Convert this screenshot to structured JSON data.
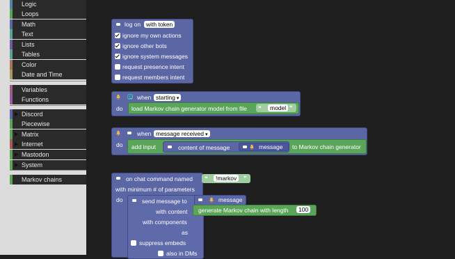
{
  "toolbox": {
    "categories": [
      {
        "label": "Logic",
        "color": "#5b80a5"
      },
      {
        "label": "Loops",
        "color": "#5ba55b"
      },
      {
        "label": "Math",
        "color": "#5b67a5"
      },
      {
        "label": "Text",
        "color": "#5ba58c"
      },
      {
        "label": "Lists",
        "color": "#745ba5"
      },
      {
        "label": "Tables",
        "color": "#5ba58c"
      },
      {
        "label": "Color",
        "color": "#a5745b"
      },
      {
        "label": "Date and Time",
        "color": "#a59b5b"
      },
      {
        "label": "Variables",
        "color": "#a55b80"
      },
      {
        "label": "Functions",
        "color": "#995ba5"
      },
      {
        "label": "Discord",
        "color": "#5b67a5"
      },
      {
        "label": "Piecewise",
        "color": "#5ba55b"
      },
      {
        "label": "Matrix",
        "color": "#5ba55b"
      },
      {
        "label": "Internet",
        "color": "#a55b5b"
      },
      {
        "label": "Mastodon",
        "color": "#5ba55b"
      },
      {
        "label": "System",
        "color": "#5ba55b"
      },
      {
        "label": "Markov chains",
        "color": "#5ba55b"
      }
    ]
  },
  "workspace": {
    "login": {
      "label": "log on",
      "token_field": "with token",
      "options": [
        {
          "label": "ignore my own actions",
          "checked": true
        },
        {
          "label": "ignore other bots",
          "checked": true
        },
        {
          "label": "ignore system messages",
          "checked": true
        },
        {
          "label": "request presence intent",
          "checked": false
        },
        {
          "label": "request members intent",
          "checked": false
        }
      ]
    },
    "starting": {
      "when": "when",
      "event": "starting",
      "do": "do",
      "action": "load Markov chain generator model from file",
      "file": "model"
    },
    "received": {
      "when": "when",
      "event": "message received",
      "do": "do",
      "add": "add input",
      "content": "content of message",
      "message": "message",
      "target": "to Markov chain generator"
    },
    "command": {
      "label": "on chat command named",
      "name": "!markov",
      "min": "with minimum # of parameters",
      "do": "do",
      "send": "send message to",
      "message": "message",
      "with_content": "with content",
      "generate": "generate Markov chain with length",
      "length": "100",
      "components": "with components",
      "as": "as",
      "suppress": "suppress embeds",
      "dms": "also in DMs"
    }
  }
}
